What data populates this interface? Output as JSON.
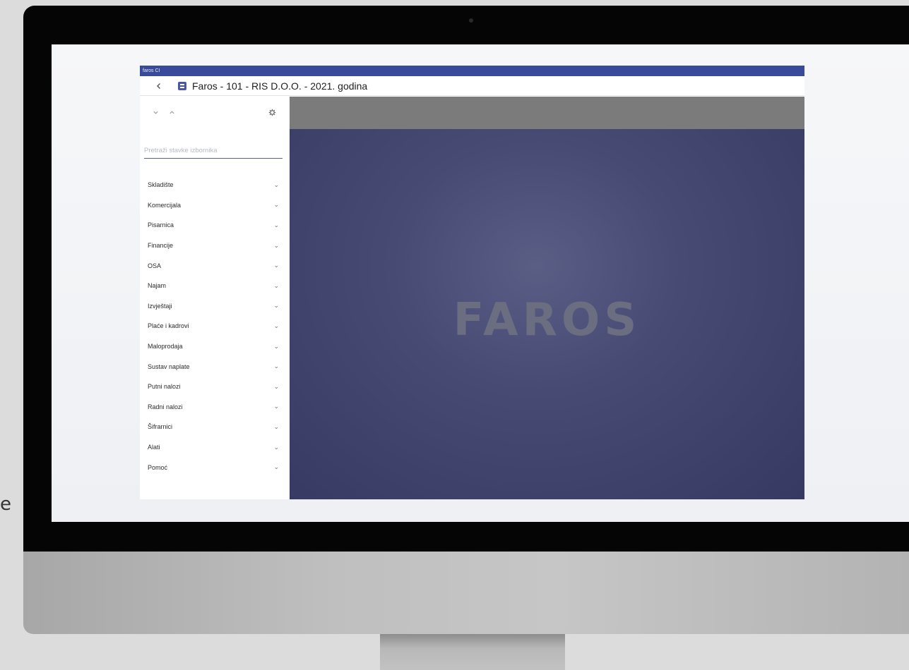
{
  "page_edge_text": "e",
  "app": {
    "window_title": "faros CI",
    "header_title": "Faros - 101 - RIS D.O.O. - 2021. godina",
    "icons": {
      "back": "chevron-left-icon",
      "app": "faros-app-icon",
      "collapse": "chevron-down-icon",
      "expand": "chevron-up-icon",
      "settings": "gear-icon"
    },
    "search": {
      "placeholder": "Pretraži stavke izbornika",
      "value": ""
    },
    "menu_items": [
      "Skladište",
      "Komercijala",
      "Pisarnica",
      "Financije",
      "OSA",
      "Najam",
      "Izvještaji",
      "Plaće i kadrovi",
      "Maloprodaja",
      "Sustav naplate",
      "Putni nalozi",
      "Radni nalozi",
      "Šifrarnici",
      "Alati",
      "Pomoć"
    ],
    "logo": "FAROS"
  },
  "colors": {
    "titlebar": "#3a4a9a",
    "main_background": "#474b74",
    "main_topbar": "#7b7b7b",
    "logo_text": "#6b6d80"
  }
}
